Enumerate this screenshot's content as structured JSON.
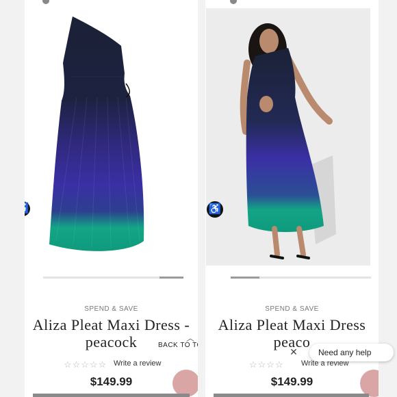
{
  "left_panel": {
    "promo": "SPEND & SAVE",
    "title_line1": "Aliza Pleat Maxi Dress -",
    "title_line2": "peacock",
    "stars": "☆☆☆☆☆",
    "review_label": "Write a review",
    "price": "$149.99",
    "back_to_top": "BACK TO TO",
    "carousel_progress": 0.17
  },
  "right_panel": {
    "promo": "SPEND & SAVE",
    "title_line1": "Aliza Pleat Maxi Dress",
    "title_line2": "peaco",
    "stars": "☆☆☆☆",
    "review_label": "Write a review",
    "price": "$149.99",
    "chat_text": "Need any help",
    "carousel_progress": 0.2
  },
  "icons": {
    "accessibility": "accessibility-icon",
    "chat_close": "close-icon",
    "back_to_top": "chevron-up-icon"
  },
  "colors": {
    "dress_navy": "#1b2136",
    "dress_purple": "#3b2fa5",
    "dress_teal": "#13a586",
    "accent_pink": "#d9a6a5"
  }
}
